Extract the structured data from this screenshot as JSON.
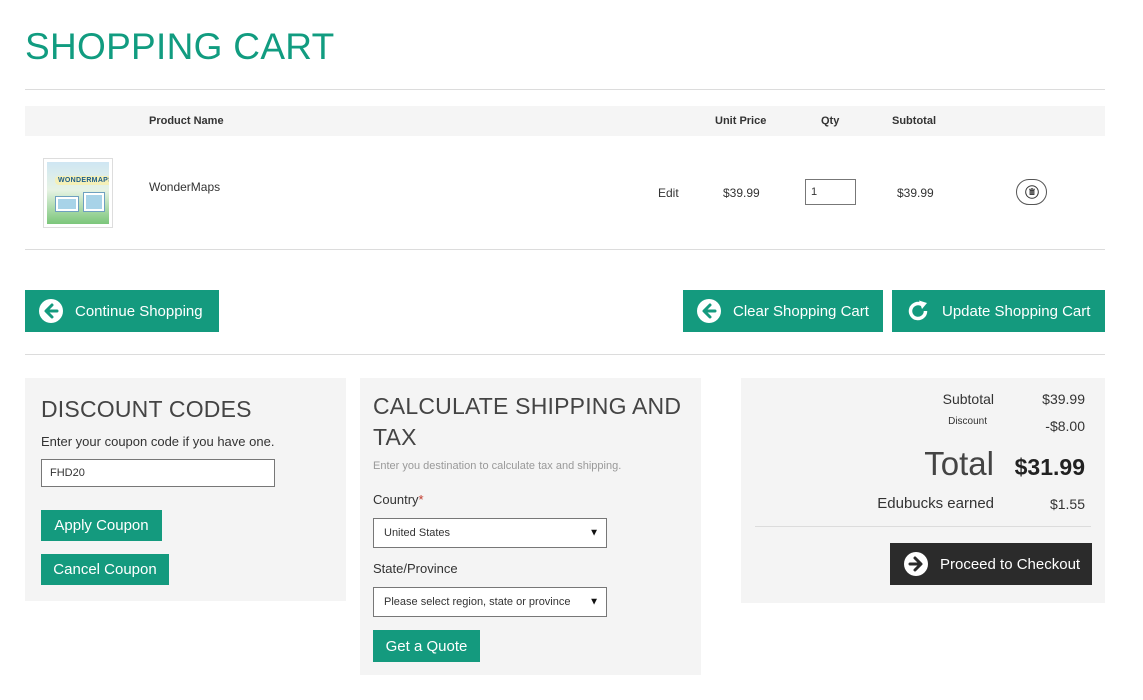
{
  "page": {
    "title": "SHOPPING CART"
  },
  "table": {
    "headers": {
      "product_name": "Product Name",
      "unit_price": "Unit Price",
      "qty": "Qty",
      "subtotal": "Subtotal"
    },
    "rows": [
      {
        "product_name": "WonderMaps",
        "thumbnail_logo": "WONDERMAPS",
        "edit_label": "Edit",
        "unit_price": "$39.99",
        "qty": "1",
        "subtotal": "$39.99",
        "remove_icon": "trash-icon"
      }
    ]
  },
  "actions": {
    "continue_label": "Continue Shopping",
    "clear_label": "Clear Shopping Cart",
    "update_label": "Update Shopping Cart"
  },
  "discount": {
    "title": "DISCOUNT CODES",
    "hint": "Enter your coupon code if you have one.",
    "code_value": "FHD20",
    "apply_label": "Apply Coupon",
    "cancel_label": "Cancel Coupon"
  },
  "shipping": {
    "title_line1": "CALCULATE SHIPPING AND",
    "title_line2": "TAX",
    "hint": "Enter you destination to calculate tax and shipping.",
    "country_label": "Country",
    "required_mark": "*",
    "country_value": "United States",
    "state_label": "State/Province",
    "state_value": "Please select region, state or province",
    "quote_label": "Get a Quote"
  },
  "totals": {
    "subtotal_label": "Subtotal",
    "subtotal_value": "$39.99",
    "discount_label": "Discount",
    "discount_value": "-$8.00",
    "total_label": "Total",
    "total_value": "$31.99",
    "edubucks_label": "Edubucks earned",
    "edubucks_value": "$1.55",
    "checkout_label": "Proceed to Checkout"
  },
  "colors": {
    "accent": "#149a7e",
    "title": "#119c80",
    "dark_button": "#2b2b2b",
    "panel": "#f4f4f4"
  }
}
